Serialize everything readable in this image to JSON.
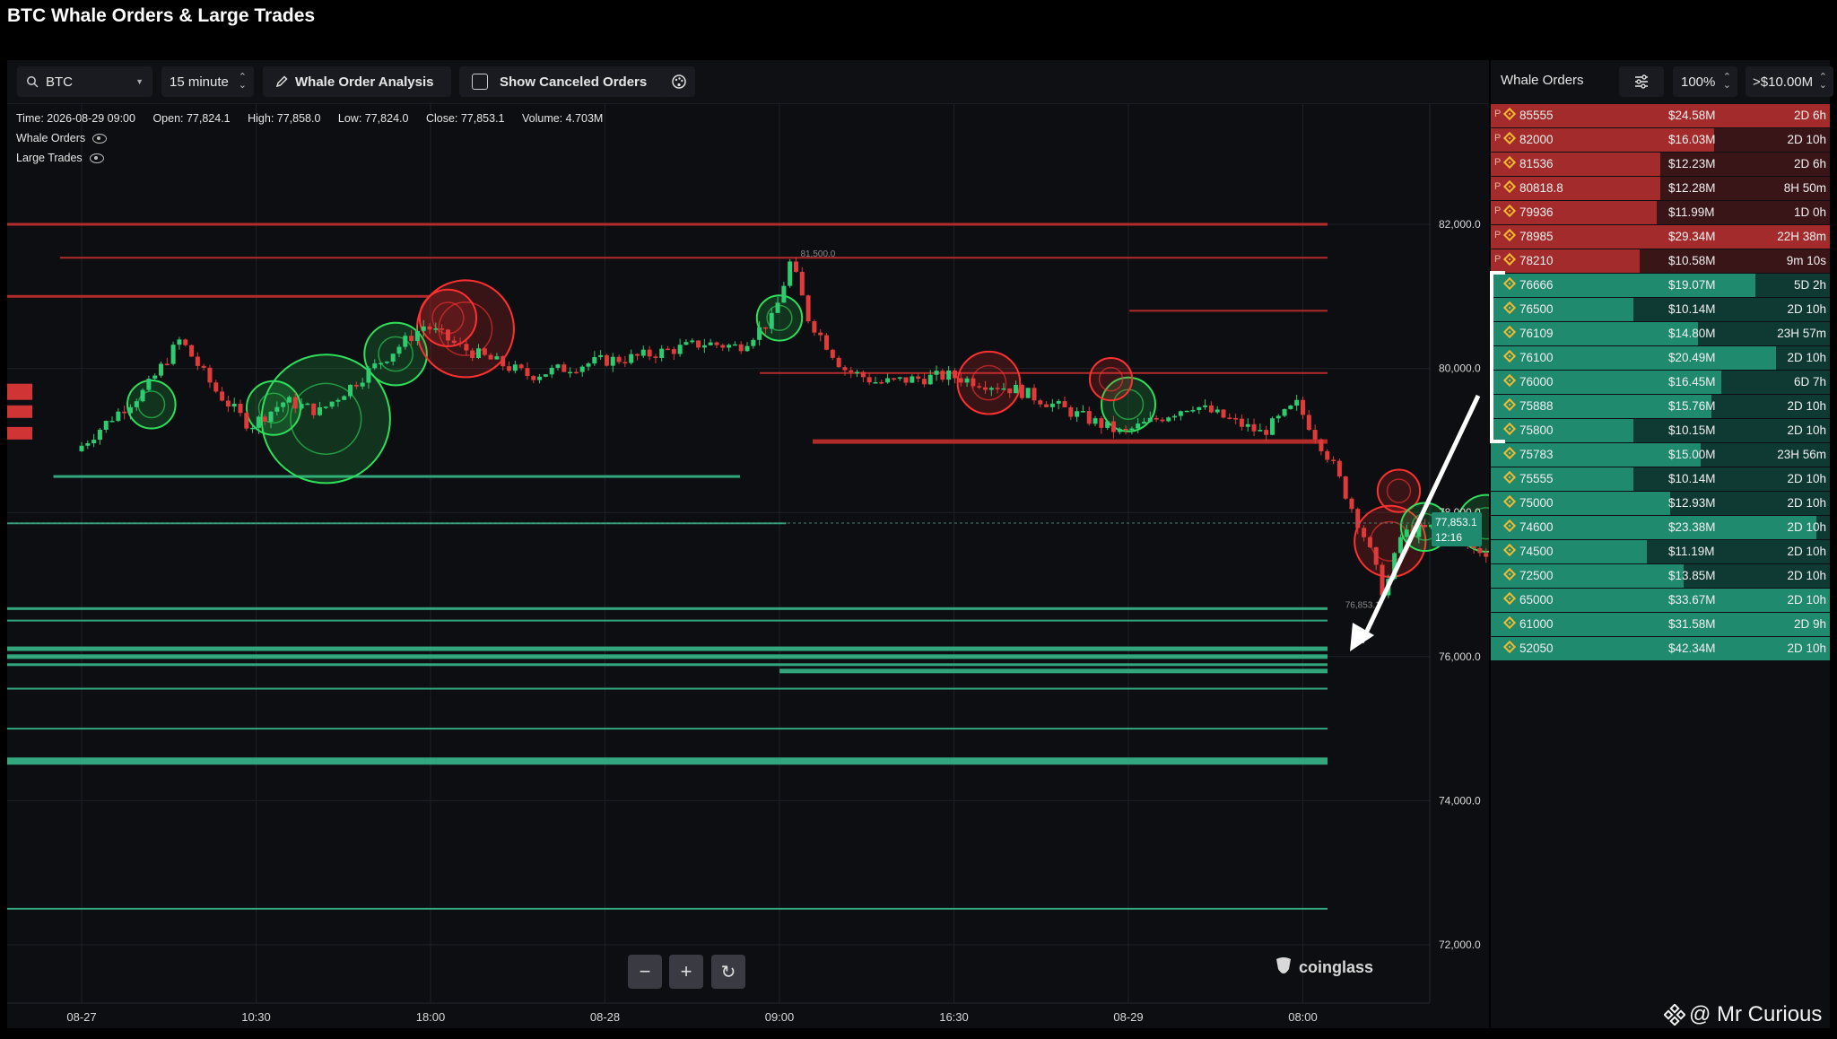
{
  "page_title": "BTC Whale Orders & Large Trades",
  "toolbar": {
    "symbol": "BTC",
    "interval": "15 minute",
    "analysis_label": "Whale Order Analysis",
    "show_canceled_label": "Show Canceled Orders",
    "show_canceled_checked": false
  },
  "ohlc": {
    "time": "Time: 2026-08-29 09:00",
    "open": "Open: 77,824.1",
    "high": "High: 77,858.0",
    "low": "Low: 77,824.0",
    "close": "Close: 77,853.1",
    "volume": "Volume: 4.703M"
  },
  "legend": {
    "whale_orders": "Whale Orders",
    "large_trades": "Large Trades"
  },
  "price_axis": [
    "82,000.0",
    "80,000.0",
    "78,000.0",
    "76,000.0",
    "74,000.0",
    "72,000.0"
  ],
  "time_axis": [
    "08-27",
    "10:30",
    "18:00",
    "08-28",
    "09:00",
    "16:30",
    "08-29",
    "08:00"
  ],
  "last_price": {
    "value": "77,853.1",
    "countdown": "12:16"
  },
  "annotations": {
    "high_marker": "81,500.0",
    "low_marker": "76,853.1"
  },
  "zoom": {
    "minus": "−",
    "plus": "+",
    "reset": "↻"
  },
  "watermark": "coinglass",
  "credit": "@ Mr Curious",
  "panel": {
    "title": "Whale Orders",
    "percent": "100%",
    "threshold": ">$10.00M"
  },
  "orders": [
    {
      "side": "ask",
      "prefix": "P",
      "price": "85555",
      "amount": "$24.58M",
      "age": "2D 6h",
      "fill": 1.0
    },
    {
      "side": "ask",
      "prefix": "P",
      "price": "82000",
      "amount": "$16.03M",
      "age": "2D 10h",
      "fill": 0.66
    },
    {
      "side": "ask",
      "prefix": "P",
      "price": "81536",
      "amount": "$12.23M",
      "age": "2D 6h",
      "fill": 0.5
    },
    {
      "side": "ask",
      "prefix": "P",
      "price": "80818.8",
      "amount": "$12.28M",
      "age": "8H 50m",
      "fill": 0.5
    },
    {
      "side": "ask",
      "prefix": "P",
      "price": "79936",
      "amount": "$11.99M",
      "age": "1D 0h",
      "fill": 0.49
    },
    {
      "side": "ask",
      "prefix": "P",
      "price": "78985",
      "amount": "$29.34M",
      "age": "22H 38m",
      "fill": 1.0
    },
    {
      "side": "ask",
      "prefix": "P",
      "price": "78210",
      "amount": "$10.58M",
      "age": "9m 10s",
      "fill": 0.44
    },
    {
      "side": "bid",
      "prefix": "",
      "price": "76666",
      "amount": "$19.07M",
      "age": "5D 2h",
      "fill": 0.78
    },
    {
      "side": "bid",
      "prefix": "",
      "price": "76500",
      "amount": "$10.14M",
      "age": "2D 10h",
      "fill": 0.42
    },
    {
      "side": "bid",
      "prefix": "",
      "price": "76109",
      "amount": "$14.80M",
      "age": "23H 57m",
      "fill": 0.61
    },
    {
      "side": "bid",
      "prefix": "",
      "price": "76100",
      "amount": "$20.49M",
      "age": "2D 10h",
      "fill": 0.84
    },
    {
      "side": "bid",
      "prefix": "",
      "price": "76000",
      "amount": "$16.45M",
      "age": "6D 7h",
      "fill": 0.68
    },
    {
      "side": "bid",
      "prefix": "",
      "price": "75888",
      "amount": "$15.76M",
      "age": "2D 10h",
      "fill": 0.65
    },
    {
      "side": "bid",
      "prefix": "",
      "price": "75800",
      "amount": "$10.15M",
      "age": "2D 10h",
      "fill": 0.42
    },
    {
      "side": "bid",
      "prefix": "",
      "price": "75783",
      "amount": "$15.00M",
      "age": "23H 56m",
      "fill": 0.62
    },
    {
      "side": "bid",
      "prefix": "",
      "price": "75555",
      "amount": "$10.14M",
      "age": "2D 10h",
      "fill": 0.42
    },
    {
      "side": "bid",
      "prefix": "",
      "price": "75000",
      "amount": "$12.93M",
      "age": "2D 10h",
      "fill": 0.53
    },
    {
      "side": "bid",
      "prefix": "",
      "price": "74600",
      "amount": "$23.38M",
      "age": "2D 10h",
      "fill": 0.96
    },
    {
      "side": "bid",
      "prefix": "",
      "price": "74500",
      "amount": "$11.19M",
      "age": "2D 10h",
      "fill": 0.46
    },
    {
      "side": "bid",
      "prefix": "",
      "price": "72500",
      "amount": "$13.85M",
      "age": "2D 10h",
      "fill": 0.57
    },
    {
      "side": "bid",
      "prefix": "",
      "price": "65000",
      "amount": "$33.67M",
      "age": "2D 10h",
      "fill": 1.0
    },
    {
      "side": "bid",
      "prefix": "",
      "price": "61000",
      "amount": "$31.58M",
      "age": "2D 9h",
      "fill": 1.0
    },
    {
      "side": "bid",
      "prefix": "",
      "price": "52050",
      "amount": "$42.34M",
      "age": "2D 10h",
      "fill": 1.0
    }
  ],
  "colors": {
    "ask": "#a32b2b",
    "ask_dark": "#3a1518",
    "bid": "#1f8a6e",
    "bid_dark": "#0f3a33",
    "up": "#2ecc71",
    "down": "#e03a3a",
    "bg": "#0d0e12"
  },
  "chart_data": {
    "type": "candlestick",
    "symbol": "BTC",
    "interval": "15 minute",
    "ylim": [
      71700,
      83000
    ],
    "x_ticks": [
      "08-27",
      "10:30",
      "18:00",
      "08-28",
      "09:00",
      "16:30",
      "08-29",
      "08:00"
    ],
    "y_ticks": [
      82000,
      80000,
      78000,
      76000,
      74000,
      72000
    ],
    "grid": true,
    "ohlc_last": {
      "time": "2026-08-29 09:00",
      "open": 77824.1,
      "high": 77858.0,
      "low": 77824.0,
      "close": 77853.1,
      "volume": "4.703M"
    },
    "price_path": [
      [
        0,
        78850
      ],
      [
        0.2,
        79300
      ],
      [
        0.4,
        79700
      ],
      [
        0.6,
        80400
      ],
      [
        0.8,
        79700
      ],
      [
        1.0,
        79200
      ],
      [
        1.2,
        79550
      ],
      [
        1.4,
        79400
      ],
      [
        1.6,
        79800
      ],
      [
        1.8,
        80200
      ],
      [
        2.0,
        80600
      ],
      [
        2.2,
        80300
      ],
      [
        2.4,
        80100
      ],
      [
        2.6,
        79900
      ],
      [
        2.8,
        80000
      ],
      [
        3.0,
        80100
      ],
      [
        3.2,
        80150
      ],
      [
        3.4,
        80250
      ],
      [
        3.6,
        80350
      ],
      [
        3.8,
        80300
      ],
      [
        4.0,
        80700
      ],
      [
        4.1,
        81500
      ],
      [
        4.2,
        80700
      ],
      [
        4.4,
        80000
      ],
      [
        4.6,
        79800
      ],
      [
        4.8,
        79850
      ],
      [
        5.0,
        79900
      ],
      [
        5.2,
        79800
      ],
      [
        5.4,
        79700
      ],
      [
        5.6,
        79500
      ],
      [
        5.8,
        79300
      ],
      [
        6.0,
        79100
      ],
      [
        6.2,
        79300
      ],
      [
        6.4,
        79500
      ],
      [
        6.6,
        79300
      ],
      [
        6.8,
        79100
      ],
      [
        7.0,
        79500
      ],
      [
        7.2,
        78700
      ],
      [
        7.4,
        77600
      ],
      [
        7.5,
        76853
      ],
      [
        7.6,
        77700
      ],
      [
        7.8,
        77800
      ],
      [
        8.0,
        77500
      ],
      [
        8.2,
        77400
      ],
      [
        8.4,
        77350
      ],
      [
        8.6,
        77600
      ],
      [
        8.8,
        77850
      ],
      [
        9.0,
        77900
      ],
      [
        9.2,
        77800
      ],
      [
        9.4,
        77650
      ],
      [
        9.6,
        77700
      ],
      [
        9.8,
        77600
      ],
      [
        10.0,
        77500
      ],
      [
        10.2,
        77550
      ],
      [
        10.4,
        77500
      ],
      [
        10.6,
        77600
      ],
      [
        10.8,
        77700
      ],
      [
        11.0,
        77650
      ],
      [
        11.2,
        77650
      ],
      [
        11.4,
        77700
      ],
      [
        11.6,
        77750
      ],
      [
        11.8,
        77700
      ],
      [
        12.0,
        77800
      ],
      [
        12.2,
        77850
      ],
      [
        12.4,
        78000
      ],
      [
        12.6,
        77853
      ]
    ],
    "whale_order_lines": [
      {
        "price": 82000,
        "side": "ask",
        "x_start": 0,
        "x_end": 1,
        "weight": 2
      },
      {
        "price": 81536,
        "side": "ask",
        "x_start": 0.04,
        "x_end": 1,
        "weight": 1
      },
      {
        "price": 81000,
        "side": "ask",
        "x_start": 0,
        "x_end": 0.32,
        "weight": 2
      },
      {
        "price": 80800,
        "side": "ask",
        "x_start": 0.85,
        "x_end": 1,
        "weight": 1
      },
      {
        "price": 79936,
        "side": "ask",
        "x_start": 0.57,
        "x_end": 1,
        "weight": 1
      },
      {
        "price": 78985,
        "side": "ask",
        "x_start": 0.61,
        "x_end": 1,
        "weight": 3
      },
      {
        "price": 78500,
        "side": "bid",
        "x_start": 0.035,
        "x_end": 0.555,
        "weight": 2
      },
      {
        "price": 77850,
        "side": "bid",
        "x_start": 0,
        "x_end": 0.59,
        "weight": 1
      },
      {
        "price": 76666,
        "side": "bid",
        "x_start": 0,
        "x_end": 1,
        "weight": 2
      },
      {
        "price": 76500,
        "side": "bid",
        "x_start": 0,
        "x_end": 1,
        "weight": 1
      },
      {
        "price": 76109,
        "side": "bid",
        "x_start": 0,
        "x_end": 1,
        "weight": 3
      },
      {
        "price": 76000,
        "side": "bid",
        "x_start": 0,
        "x_end": 1,
        "weight": 3
      },
      {
        "price": 75888,
        "side": "bid",
        "x_start": 0,
        "x_end": 1,
        "weight": 2
      },
      {
        "price": 75800,
        "side": "bid",
        "x_start": 0.585,
        "x_end": 1,
        "weight": 3
      },
      {
        "price": 75555,
        "side": "bid",
        "x_start": 0,
        "x_end": 1,
        "weight": 1
      },
      {
        "price": 75000,
        "side": "bid",
        "x_start": 0,
        "x_end": 1,
        "weight": 1
      },
      {
        "price": 74550,
        "side": "bid",
        "x_start": 0,
        "x_end": 1,
        "weight": 4
      },
      {
        "price": 72500,
        "side": "bid",
        "x_start": 0,
        "x_end": 1,
        "weight": 1
      }
    ],
    "large_trades": [
      {
        "x": 1.4,
        "price": 79300,
        "side": "buy",
        "size": 3.6
      },
      {
        "x": 1.1,
        "price": 79450,
        "side": "buy",
        "size": 1.0
      },
      {
        "x": 0.4,
        "price": 79500,
        "side": "buy",
        "size": 0.8
      },
      {
        "x": 1.8,
        "price": 80200,
        "side": "buy",
        "size": 1.3
      },
      {
        "x": 2.2,
        "price": 80550,
        "side": "sell",
        "size": 2.5
      },
      {
        "x": 2.1,
        "price": 80700,
        "side": "sell",
        "size": 1.1
      },
      {
        "x": 4.0,
        "price": 80700,
        "side": "buy",
        "size": 0.7
      },
      {
        "x": 5.2,
        "price": 79800,
        "side": "sell",
        "size": 1.3
      },
      {
        "x": 6.0,
        "price": 79500,
        "side": "buy",
        "size": 1.0
      },
      {
        "x": 5.9,
        "price": 79850,
        "side": "sell",
        "size": 0.6
      },
      {
        "x": 7.5,
        "price": 77600,
        "side": "sell",
        "size": 1.6
      },
      {
        "x": 7.55,
        "price": 78300,
        "side": "sell",
        "size": 0.6
      },
      {
        "x": 8.05,
        "price": 77850,
        "side": "buy",
        "size": 1.1
      },
      {
        "x": 7.7,
        "price": 77800,
        "side": "buy",
        "size": 0.8
      },
      {
        "x": 8.8,
        "price": 77550,
        "side": "buy",
        "size": 0.9
      },
      {
        "x": 9.6,
        "price": 77800,
        "side": "buy",
        "size": 0.5
      },
      {
        "x": 11.2,
        "price": 77600,
        "side": "buy",
        "size": 0.5
      },
      {
        "x": 12.2,
        "price": 77800,
        "side": "buy",
        "size": 0.5
      }
    ],
    "last_price": 77853.1,
    "high_marker": 81500.0,
    "low_marker": 76853.1
  }
}
